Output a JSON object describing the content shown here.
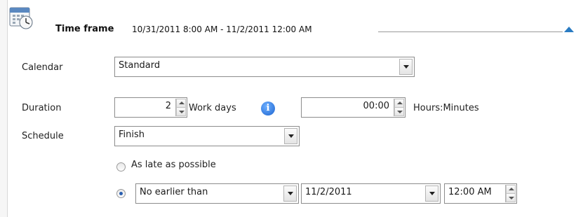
{
  "header": {
    "title": "Time frame",
    "range": "10/31/2011 8:00 AM - 11/2/2011 12:00 AM"
  },
  "calendar": {
    "label": "Calendar",
    "value": "Standard"
  },
  "duration": {
    "label": "Duration",
    "value": "2",
    "unit": "Work days",
    "time_value": "00:00",
    "time_unit": "Hours:Minutes"
  },
  "schedule": {
    "label": "Schedule",
    "value": "Finish",
    "option_late": "As late as possible",
    "constraint_value": "No earlier than",
    "date_value": "11/2/2011",
    "time_value": "12:00 AM"
  },
  "colors": {
    "accent": "#2a7bc2"
  }
}
